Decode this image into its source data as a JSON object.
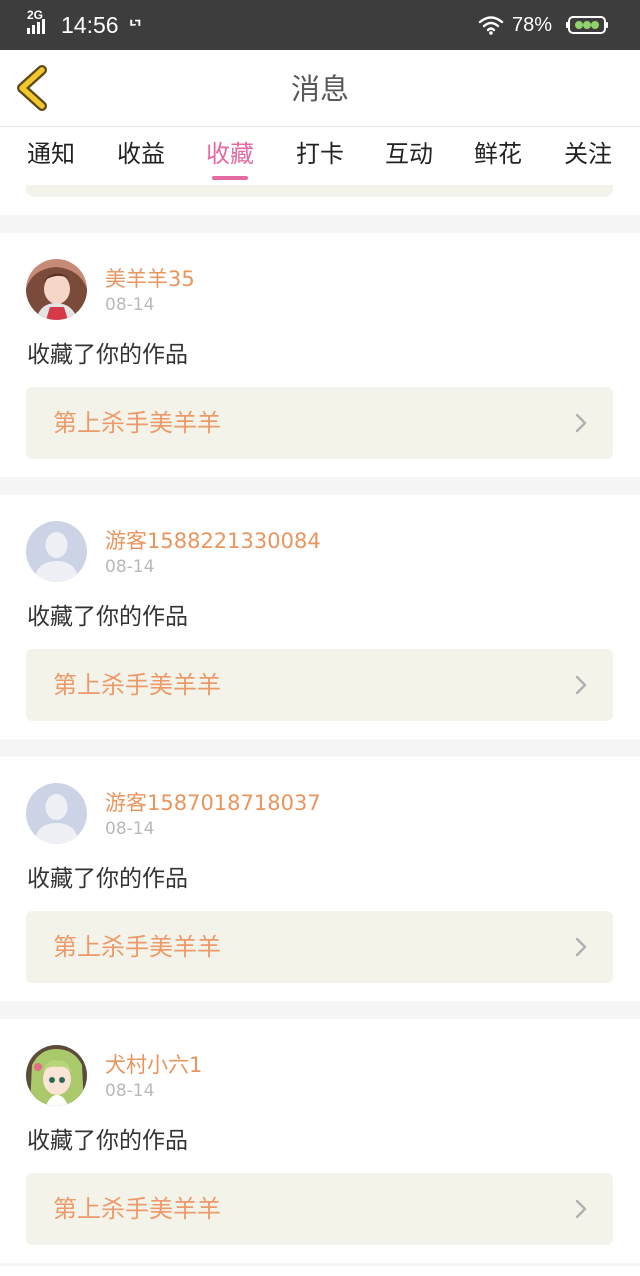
{
  "status_bar": {
    "network": "2G",
    "time": "14:56",
    "extra_icon": "ᄓ",
    "battery": "78%"
  },
  "header": {
    "title": "消息"
  },
  "tabs": [
    {
      "label": "通知"
    },
    {
      "label": "收益"
    },
    {
      "label": "收藏"
    },
    {
      "label": "打卡"
    },
    {
      "label": "互动"
    },
    {
      "label": "鲜花"
    },
    {
      "label": "关注"
    }
  ],
  "active_tab": "收藏",
  "colors": {
    "accent": "#e569a3",
    "username": "#e8955e",
    "work_title": "#ed9a6a",
    "work_box_bg": "#f4f3ea"
  },
  "feed": [
    {
      "username": "美羊羊35",
      "date": "08-14",
      "action": "收藏了你的作品",
      "work_title": "第上杀手美羊羊",
      "avatar_icon": "girl-photo-avatar"
    },
    {
      "username": "游客1588221330084",
      "date": "08-14",
      "action": "收藏了你的作品",
      "work_title": "第上杀手美羊羊",
      "avatar_icon": "default-user-avatar"
    },
    {
      "username": "游客1587018718037",
      "date": "08-14",
      "action": "收藏了你的作品",
      "work_title": "第上杀手美羊羊",
      "avatar_icon": "default-user-avatar"
    },
    {
      "username": "犬村小六1",
      "date": "08-14",
      "action": "收藏了你的作品",
      "work_title": "第上杀手美羊羊",
      "avatar_icon": "anime-girl-avatar"
    }
  ]
}
